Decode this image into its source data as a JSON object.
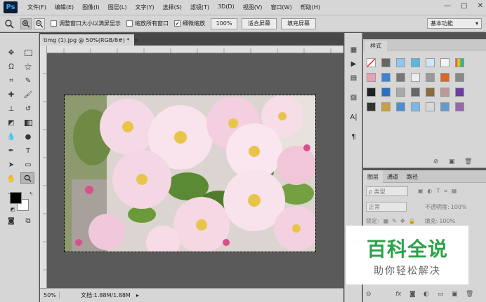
{
  "app": {
    "logo": "Ps"
  },
  "menu": [
    "文件(F)",
    "编辑(E)",
    "图像(I)",
    "图层(L)",
    "文字(Y)",
    "选择(S)",
    "滤镜(T)",
    "3D(D)",
    "视图(V)",
    "窗口(W)",
    "帮助(H)"
  ],
  "window_controls": {
    "minimize": "—",
    "maximize": "▢",
    "close": "✕"
  },
  "options": {
    "resize_windows_label": "调整窗口大小以满屏显示",
    "resize_windows_checked": false,
    "zoom_all_label": "缩放所有窗口",
    "zoom_all_checked": false,
    "scrubby_zoom_label": "细微缩放",
    "scrubby_zoom_checked": true,
    "hundred_pct": "100%",
    "fit_screen": "适合屏幕",
    "fill_screen": "填充屏幕",
    "workspace": "基本功能"
  },
  "document": {
    "tab_title": "timg (1).jpg @ 50%(RGB/8#) *",
    "tab_close": "×",
    "zoom": "50%",
    "doc_info": "文档:1.88M/1.88M"
  },
  "styles_panel": {
    "tab": "样式"
  },
  "layers_panel": {
    "tabs": [
      "图层",
      "通道",
      "路径"
    ],
    "filter_kind": "ρ 类型",
    "blend_mode": "正常",
    "opacity_label": "不透明度:",
    "opacity_value": "100%",
    "lock_label": "锁定:",
    "fill_label": "填充:",
    "fill_value": "100%"
  },
  "watermark": {
    "title": "百科全说",
    "subtitle": "助你轻松解决"
  },
  "colors": {
    "ui_bg": "#d6d6d6",
    "canvas_bg": "#5a5a5a",
    "watermark_green": "#2aa24a"
  }
}
